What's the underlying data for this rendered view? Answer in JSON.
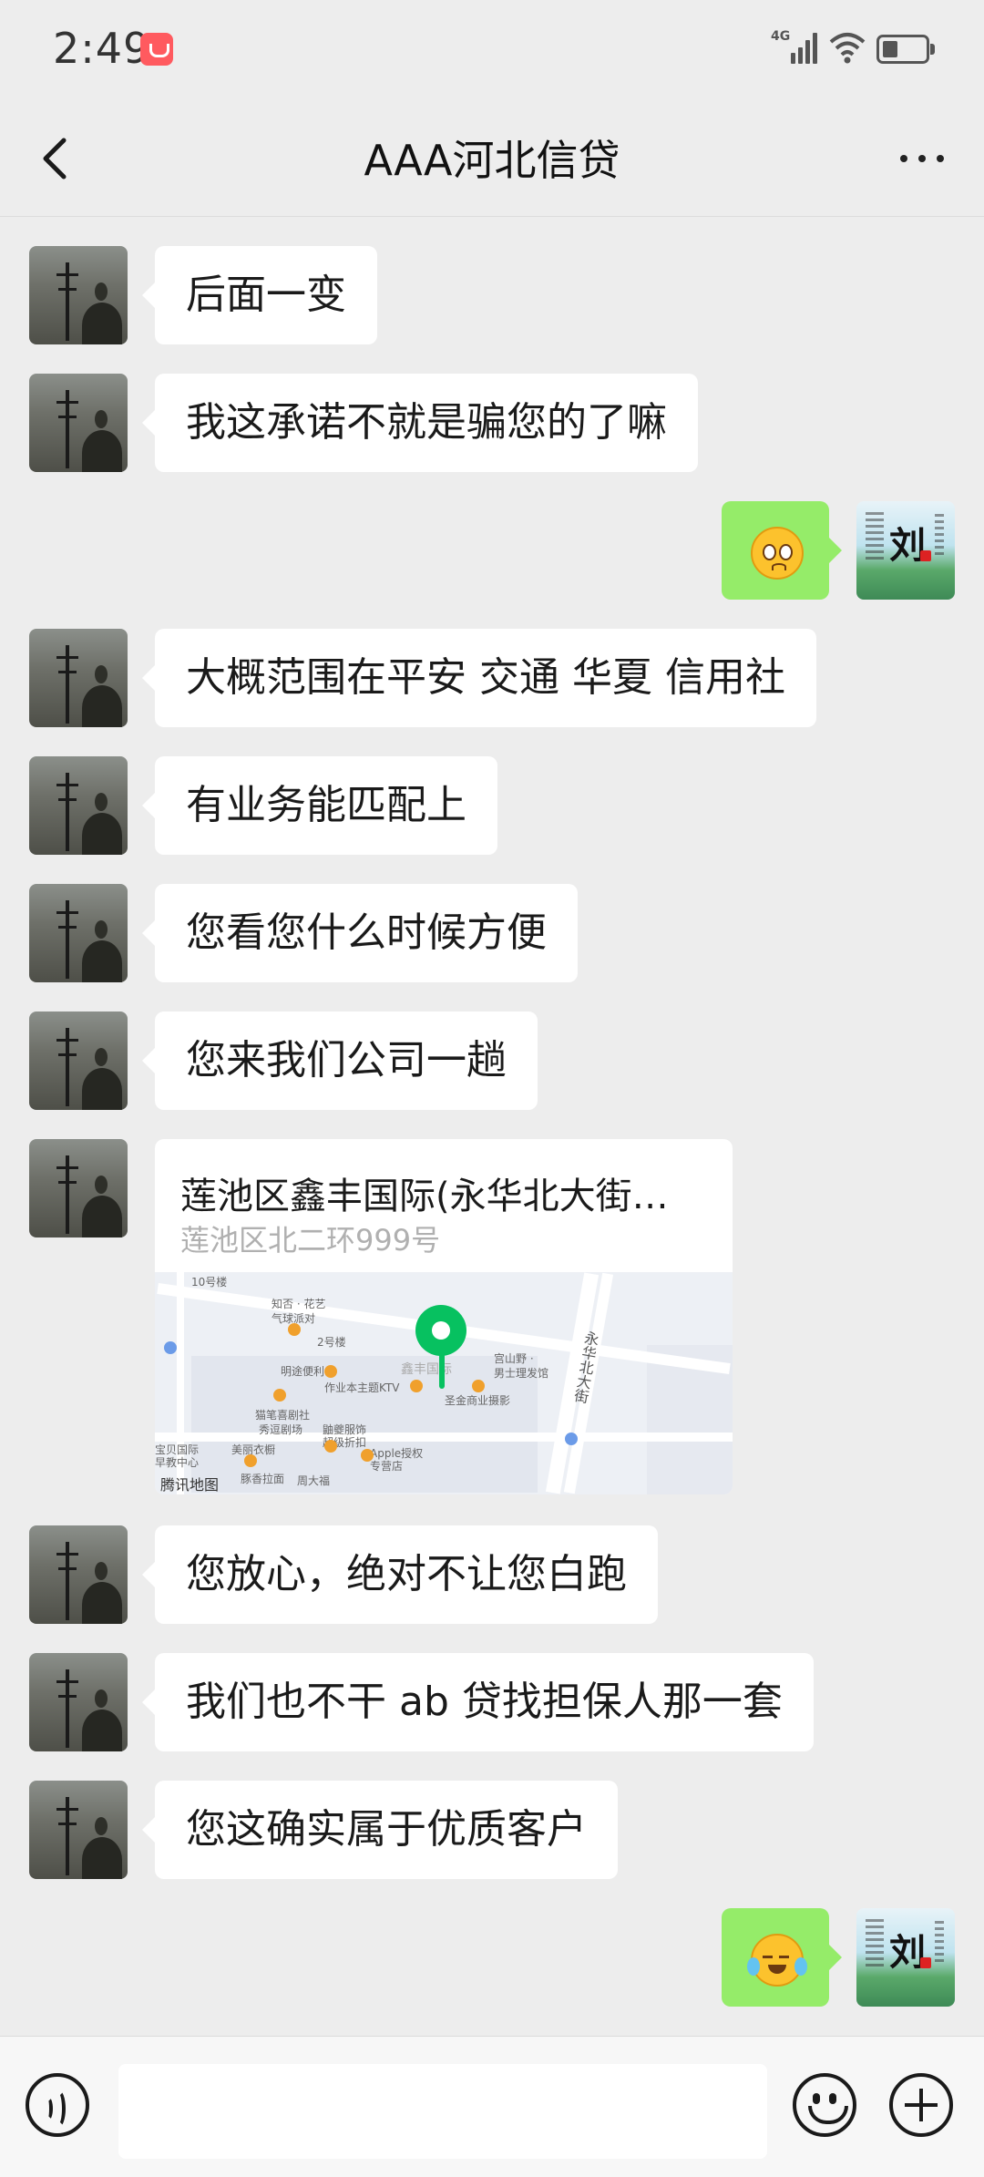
{
  "status_bar": {
    "time": "2:49",
    "network": "4G"
  },
  "header": {
    "title": "AAA河北信贷"
  },
  "messages": [
    {
      "side": "left",
      "text": "后面一变"
    },
    {
      "side": "left",
      "text": "我这承诺不就是骗您的了嘛"
    },
    {
      "side": "right",
      "emoji": "pleading-face-emoji"
    },
    {
      "side": "left",
      "text": "大概范围在平安 交通 华夏 信用社"
    },
    {
      "side": "left",
      "text": "有业务能匹配上"
    },
    {
      "side": "left",
      "text": "您看您什么时候方便"
    },
    {
      "side": "left",
      "text": "您来我们公司一趟"
    },
    {
      "side": "left",
      "location": true
    },
    {
      "side": "left",
      "text": "您放心，绝对不让您白跑"
    },
    {
      "side": "left",
      "text": "我们也不干 ab 贷找担保人那一套"
    },
    {
      "side": "left",
      "text": "您这确实属于优质客户"
    },
    {
      "side": "right",
      "emoji": "laugh-cry-emoji"
    }
  ],
  "location": {
    "title": "莲池区鑫丰国际(永华北大街…",
    "address": "莲池区北二环999号",
    "map_labels": {
      "l1": "10号楼",
      "l2": "知否 · 花艺",
      "l3": "气球派对",
      "l4": "2号楼",
      "l5": "明途便利",
      "l6": "鑫丰国际",
      "l7": "宫山野 ·",
      "l8": "男士理发馆",
      "l9": "作业本主题KTV",
      "l10": "圣金商业摄影",
      "l11": "永华北大街",
      "l12": "猫笔喜剧社",
      "l13": "秀逗剧场",
      "l14": "鼬夔服饰",
      "l15": "超级折扣",
      "l16": "宝贝国际",
      "l17": "早教中心",
      "l18": "美丽衣橱",
      "l19": "Apple授权",
      "l20": "专营店",
      "l21": "豚香拉面",
      "l22": "周大福",
      "l23": "腾讯地图"
    }
  },
  "colors": {
    "background": "#ededed",
    "self_bubble": "#95ec69",
    "other_bubble": "#ffffff",
    "map_pin": "#07c160"
  }
}
